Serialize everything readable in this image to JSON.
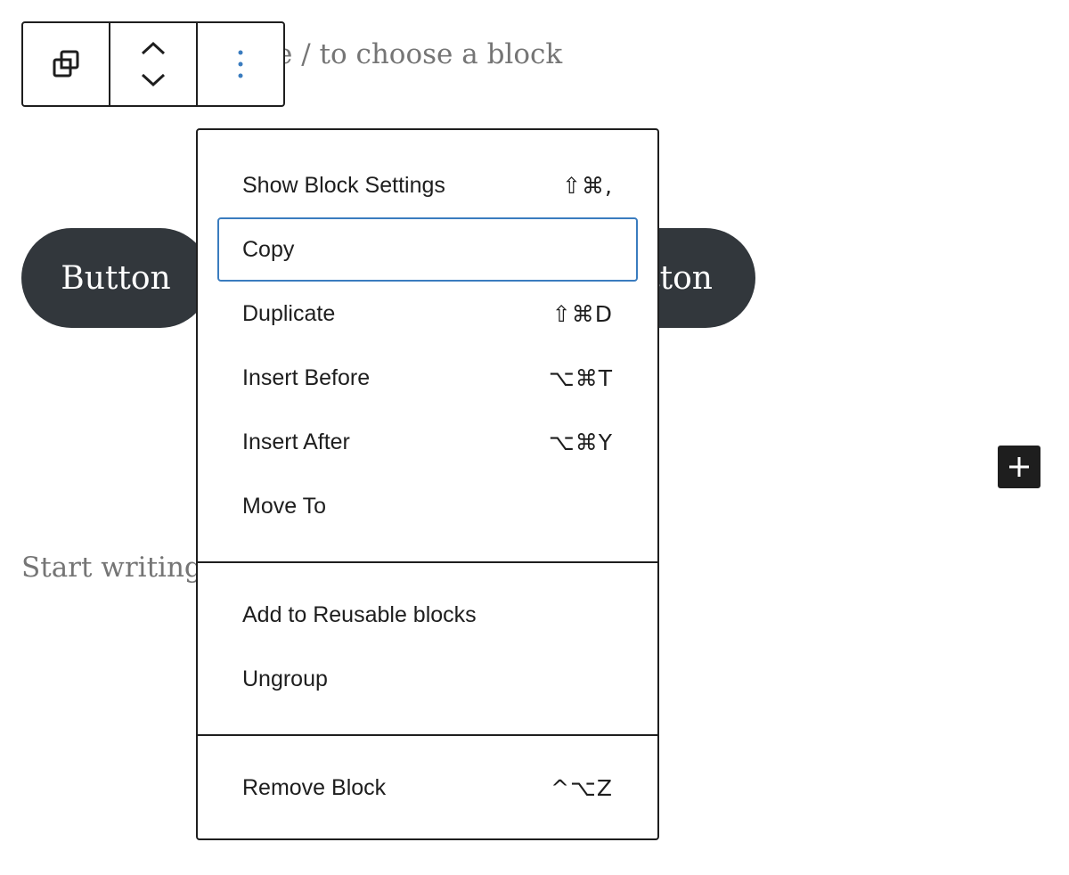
{
  "editor": {
    "placeholder_top": "e / to choose a block",
    "button_left_label": "Button",
    "button_right_label": "tton",
    "start_writing_placeholder": "Start writing"
  },
  "toolbar": {
    "icons": [
      "transform-icon",
      "move-up-down-icon",
      "more-options-icon"
    ]
  },
  "menu": {
    "group1": [
      {
        "label": "Show Block Settings",
        "shortcut": "⇧⌘,"
      },
      {
        "label": "Copy",
        "shortcut": ""
      },
      {
        "label": "Duplicate",
        "shortcut": "⇧⌘D"
      },
      {
        "label": "Insert Before",
        "shortcut": "⌥⌘T"
      },
      {
        "label": "Insert After",
        "shortcut": "⌥⌘Y"
      },
      {
        "label": "Move To",
        "shortcut": ""
      }
    ],
    "group2": [
      {
        "label": "Add to Reusable blocks"
      },
      {
        "label": "Ungroup"
      }
    ],
    "group3": [
      {
        "label": "Remove Block",
        "shortcut": "^⌥Z"
      }
    ]
  },
  "colors": {
    "button_bg": "#32373c",
    "focus_ring": "#3a7cbf",
    "placeholder_text": "#757575"
  }
}
